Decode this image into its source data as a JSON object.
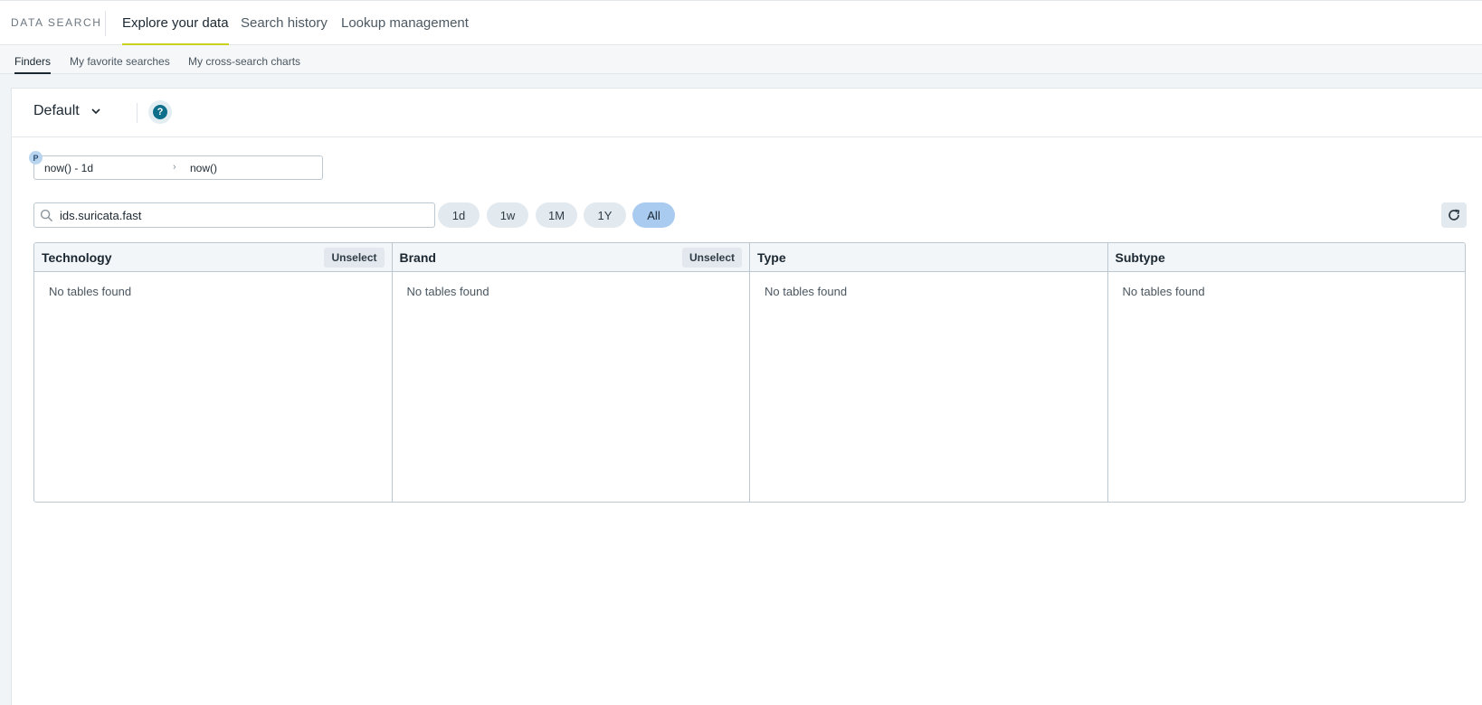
{
  "app": {
    "brand": "DATA SEARCH"
  },
  "main_tabs": [
    {
      "label": "Explore your data",
      "active": true
    },
    {
      "label": "Search history",
      "active": false
    },
    {
      "label": "Lookup management",
      "active": false
    }
  ],
  "sub_tabs": [
    {
      "label": "Finders",
      "active": true
    },
    {
      "label": "My favorite searches",
      "active": false
    },
    {
      "label": "My cross-search charts",
      "active": false
    }
  ],
  "finder": {
    "selected": "Default",
    "help_icon": "question-icon"
  },
  "date_range": {
    "badge": "P",
    "from": "now() - 1d",
    "to": "now()"
  },
  "search": {
    "value": "ids.suricata.fast",
    "placeholder": ""
  },
  "period_pills": [
    {
      "label": "1d",
      "active": false
    },
    {
      "label": "1w",
      "active": false
    },
    {
      "label": "1M",
      "active": false
    },
    {
      "label": "1Y",
      "active": false
    },
    {
      "label": "All",
      "active": true
    }
  ],
  "columns": [
    {
      "title": "Technology",
      "action": "Unselect",
      "empty_text": "No tables found"
    },
    {
      "title": "Brand",
      "action": "Unselect",
      "empty_text": "No tables found"
    },
    {
      "title": "Type",
      "action": "",
      "empty_text": "No tables found"
    },
    {
      "title": "Subtype",
      "action": "",
      "empty_text": "No tables found"
    }
  ],
  "colors": {
    "accent_underline": "#c8d11c",
    "active_pill": "#a9cbf0",
    "help": "#0e6f8a"
  }
}
